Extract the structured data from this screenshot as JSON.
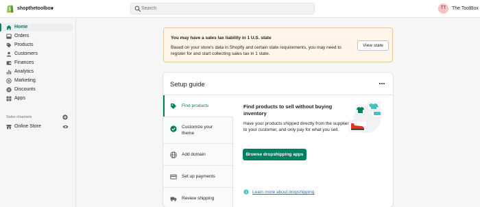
{
  "topbar": {
    "store_name": "shopthetoolbox",
    "search_placeholder": "Search",
    "avatar_initials": "TT",
    "user_name": "The ToolBox"
  },
  "sidebar": {
    "items": [
      {
        "label": "Home",
        "icon": "home-icon",
        "active": true
      },
      {
        "label": "Orders",
        "icon": "orders-icon"
      },
      {
        "label": "Products",
        "icon": "tag-icon"
      },
      {
        "label": "Customers",
        "icon": "person-icon"
      },
      {
        "label": "Finances",
        "icon": "finances-icon"
      },
      {
        "label": "Analytics",
        "icon": "bar-chart-icon"
      },
      {
        "label": "Marketing",
        "icon": "target-icon"
      },
      {
        "label": "Discounts",
        "icon": "discount-icon"
      },
      {
        "label": "Apps",
        "icon": "apps-icon"
      }
    ],
    "sales_channels_label": "Sales channels",
    "online_store_label": "Online Store"
  },
  "banner": {
    "title": "You may have a sales tax liability in 1 U.S. state",
    "text": "Based on your store's data in Shopify and certain state requirements, you may need to register for and start collecting sales tax in 1 state.",
    "button_label": "View state"
  },
  "setup_guide": {
    "title": "Setup guide",
    "steps": [
      {
        "label": "Find products",
        "icon": "products-icon",
        "active": true
      },
      {
        "label": "Customize your theme",
        "icon": "check-circle-icon"
      },
      {
        "label": "Add domain",
        "icon": "globe-icon"
      },
      {
        "label": "Set up payments",
        "icon": "payments-icon"
      },
      {
        "label": "Review shipping",
        "icon": "truck-icon"
      }
    ],
    "detail_title": "Find products to sell without buying inventory",
    "detail_text": "Have your products shipped directly from the supplier to your customer, and only pay for what you sell.",
    "primary_button": "Browse dropshipping apps",
    "learn_more": "Learn more about dropshipping"
  },
  "colors": {
    "accent": "#008060",
    "banner_bg": "#fff5ea",
    "link": "#2c6ecb",
    "avatar_bg": "#f7c2c6"
  }
}
